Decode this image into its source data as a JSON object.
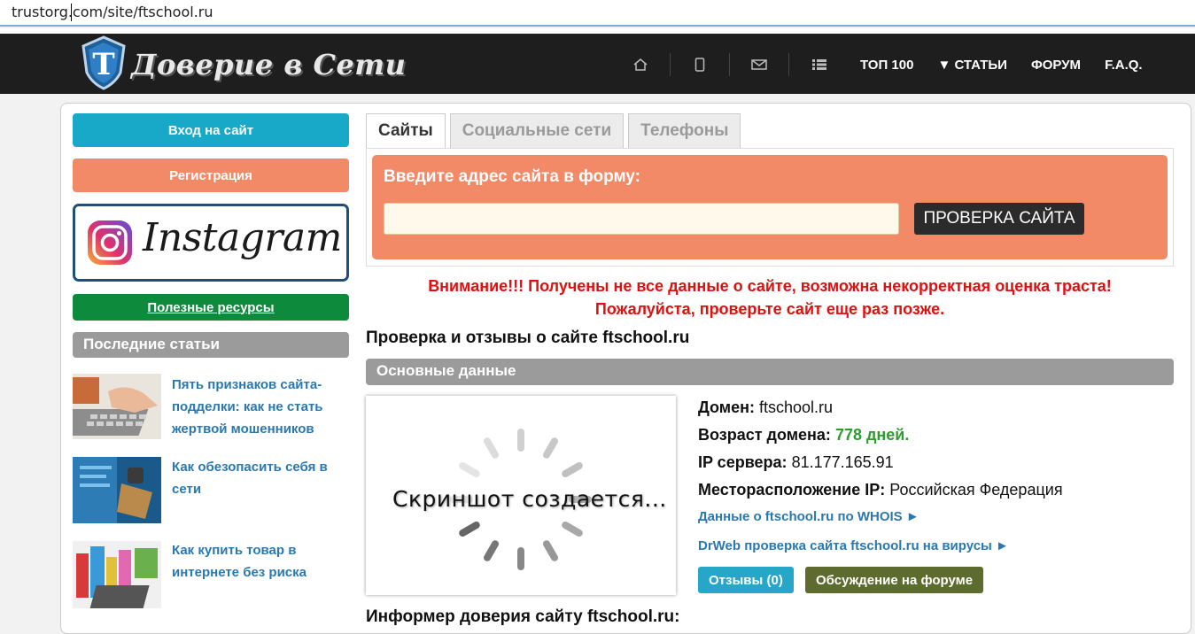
{
  "browser": {
    "url": "trustorg.com/site/ftschool.ru"
  },
  "header": {
    "logo_text": "Доверие в Сети",
    "icons": [
      "home-icon",
      "phone-icon",
      "mail-icon",
      "list-icon"
    ],
    "nav": [
      "ТОП 100",
      "▼ СТАТЬИ",
      "ФОРУМ",
      "F.A.Q."
    ]
  },
  "sidebar": {
    "login_label": "Вход на сайт",
    "register_label": "Регистрация",
    "instagram_text": "Instagram",
    "useful_label": "Полезные ресурсы",
    "last_articles_title": "Последние статьи",
    "articles": [
      {
        "title": "Пять признаков сайта-подделки: как не стать жертвой мошенников"
      },
      {
        "title": "Как обезопасить себя в сети"
      },
      {
        "title": "Как купить товар в интернете без риска"
      }
    ]
  },
  "tabs": [
    "Сайты",
    "Социальные сети",
    "Телефоны"
  ],
  "form": {
    "label": "Введите адрес сайта в форму:",
    "input_value": "",
    "button_label": "ПРОВЕРКА САЙТА"
  },
  "warning": {
    "line1": "Внимание!!! Получены не все данные о сайте, возможна некорректная оценка траста!",
    "line2": "Пожалуйста, проверьте сайт еще раз позже."
  },
  "main": {
    "heading": "Проверка и отзывы о сайте ftschool.ru",
    "section_title": "Основные данные",
    "screenshot_text": "Скриншот создается...",
    "domain_label": "Домен:",
    "domain_value": "ftschool.ru",
    "age_label": "Возраст домена:",
    "age_value": "778 дней.",
    "ip_label": "IP сервера:",
    "ip_value": "81.177.165.91",
    "location_label": "Месторасположение IP:",
    "location_value": "Российская Федерация",
    "whois_link": "Данные о ftschool.ru по WHOIS ►",
    "drweb_link": "DrWeb проверка сайта ftschool.ru на вирусы ►",
    "reviews_btn": "Отзывы (0)",
    "forum_btn": "Обсуждение на форуме",
    "informer_heading": "Информер доверия сайту ftschool.ru:"
  },
  "colors": {
    "header_bg": "#1e1e1e",
    "login_btn": "#19a9c8",
    "register_btn": "#f28a67",
    "useful_btn": "#0e8a3c",
    "accent_orange": "#f28a67",
    "warning_red": "#e01010",
    "link_blue": "#2a78b0",
    "age_green": "#2e9c2e"
  }
}
